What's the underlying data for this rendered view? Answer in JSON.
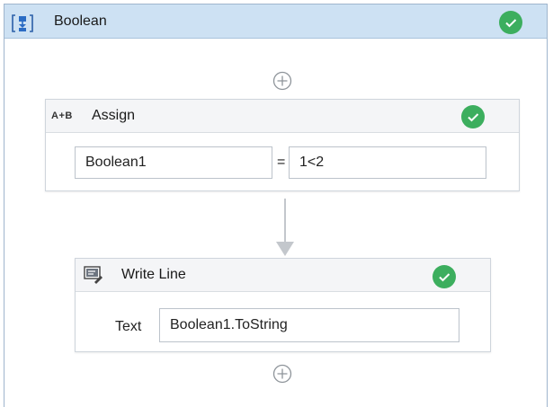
{
  "sequence": {
    "title": "Boolean",
    "status": "valid"
  },
  "assign": {
    "icon_text": "A+B",
    "title": "Assign",
    "to_value": "Boolean1",
    "operator": "=",
    "value": "1<2",
    "status": "valid"
  },
  "writeline": {
    "title": "Write Line",
    "text_label": "Text",
    "text_value": "Boolean1.ToString",
    "status": "valid"
  },
  "colors": {
    "header_bg": "#cde1f3",
    "check_green": "#3cae5e",
    "border": "#cfd5dc"
  },
  "icons": {
    "sequence": "sequence-icon",
    "assign": "assign-icon",
    "writeline": "write-line-icon",
    "valid": "check-icon",
    "add": "add-plus-icon"
  }
}
